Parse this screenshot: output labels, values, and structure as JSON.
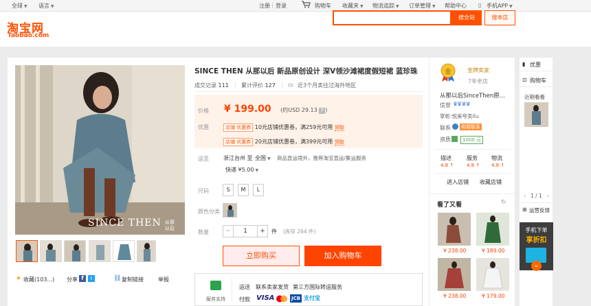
{
  "topbar": {
    "region": "全球",
    "language": "语言",
    "login": "注册",
    "register": "登录",
    "cart": "购物车",
    "favorites": "收藏夹",
    "logistics": "物流追踪",
    "orders": "订单管理",
    "help": "帮助中心",
    "mobile_app": "手机APP"
  },
  "header": {
    "logo_cn": "淘宝网",
    "logo_en": "Taobao.com",
    "search_placeholder": "",
    "search_all": "搜全站",
    "search_store": "搜本店"
  },
  "product": {
    "title": "SINCE THEN 从那以后 新品原创设计 深V领沙滩裙度假短裙 蓝珍珠",
    "deal_records_label": "成交记录",
    "deal_records": "111",
    "reviews_label": "累计评价",
    "reviews": "127",
    "sold_overseas": "近3个月卖往过海外地区",
    "price_label": "价格",
    "price": "¥ 199.00",
    "price_usd": "(约USD 29.13",
    "price_usd_close": ")",
    "promo_label": "优惠",
    "coupon_tag": "店铺 优惠券",
    "coupon1": "10元店铺优惠卷，满259元可用",
    "coupon2": "20元店铺优惠卷，满399元可用",
    "get": "领取",
    "shipping_label": "运至",
    "ship_from": "浙江台州 至",
    "ship_to": "全国",
    "ship_note": "商品直运境外，推荐淘宝直运/集运服务",
    "express": "快递 ¥5.00",
    "size_label": "尺码",
    "sizes": [
      "S",
      "M",
      "L"
    ],
    "color_label": "颜色分类",
    "qty_label": "数量",
    "qty_minus": "−",
    "qty_value": "1",
    "qty_plus": "+",
    "qty_unit": "件",
    "stock": "(库存 264 件)",
    "buy_now": "立即购买",
    "add_cart": "加入购物车",
    "favorite": "收藏(103...)",
    "share": "分享",
    "copy_link": "复制链接",
    "report": "举报",
    "watermark": "SINCE THEN",
    "watermark_cn": "从那以后"
  },
  "services": {
    "support": "服务支持",
    "shipping": "运送",
    "contact_ship": "联系卖家发货",
    "third_party": "第三方国际转运服务",
    "payment": "付款",
    "pay_methods": [
      "VISA",
      "",
      "JCB",
      "支付宝"
    ]
  },
  "shop": {
    "badge": "金牌卖家",
    "age": "7年老店",
    "name": "从那以后SinceThen原...",
    "credit_label": "信誉",
    "owner": "掌柜:悦美夸卖ilu",
    "contact": "联系",
    "contact_btn": "和我联系",
    "qualification": "资质",
    "deposit": "1000 元",
    "score_labels": [
      "描述",
      "服务",
      "物流"
    ],
    "scores": [
      "4.8",
      "4.8",
      "4.8"
    ],
    "enter_shop": "进入店铺",
    "fav_shop": "收藏店铺"
  },
  "recommend": {
    "title": "看了又看",
    "prices": [
      "¥ 238.00",
      "¥ 189.00",
      "¥ 238.00",
      "¥ 179.00"
    ]
  },
  "rail": {
    "vip": "优惠",
    "cart": "购物车",
    "recent": "近期看看",
    "pager": "1 / 1",
    "feedback": "运营反馈",
    "mobile_title": "手机下单",
    "mobile_sub": "享折扣"
  },
  "colors": {
    "brand": "#ff5000",
    "price": "#ff4400"
  }
}
